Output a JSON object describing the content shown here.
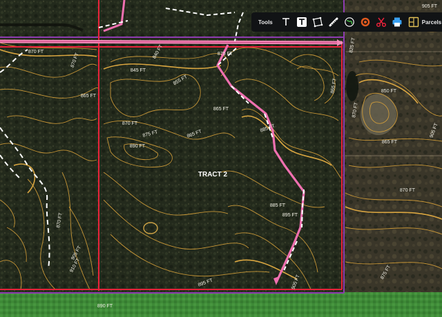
{
  "map": {
    "tract_label": "TRACT 2",
    "contour_labels": [
      "870 FT",
      "870 FT",
      "840 FT",
      "865 FT",
      "845 FT",
      "855 FT",
      "865 FT",
      "875 FT",
      "890 FT",
      "870 FT",
      "875 FT",
      "865 FT",
      "885 FT",
      "850 FT",
      "865 FT",
      "870 FT",
      "875 FT",
      "885 FT",
      "895 FT",
      "905 FT",
      "905 FT",
      "910 FT",
      "895 FT",
      "890 FT",
      "870 FT",
      "865 FT",
      "825 FT",
      "870 FT",
      "905 FT"
    ],
    "corner_label": "905 FT",
    "colors": {
      "tract_boundary": "#e8223a",
      "adjacent_boundary": "#8d3bb0",
      "trail": "#f070b0",
      "trail_dash": "#ffffff",
      "contour": "#d9a23a",
      "field": "#3f8d3a"
    }
  },
  "toolbar": {
    "label": "Tools",
    "buttons": [
      {
        "name": "text-tool",
        "icon": "text-icon"
      },
      {
        "name": "text-box-tool",
        "icon": "text-box-icon"
      },
      {
        "name": "polygon-tool",
        "icon": "polygon-icon"
      },
      {
        "name": "ruler-tool",
        "icon": "ruler-icon"
      },
      {
        "name": "globe-tool",
        "icon": "globe-icon"
      },
      {
        "name": "radius-tool",
        "icon": "target-icon"
      },
      {
        "name": "cut-tool",
        "icon": "scissors-icon"
      },
      {
        "name": "print-tool",
        "icon": "printer-icon"
      }
    ],
    "parcels_label": "Parcels"
  }
}
